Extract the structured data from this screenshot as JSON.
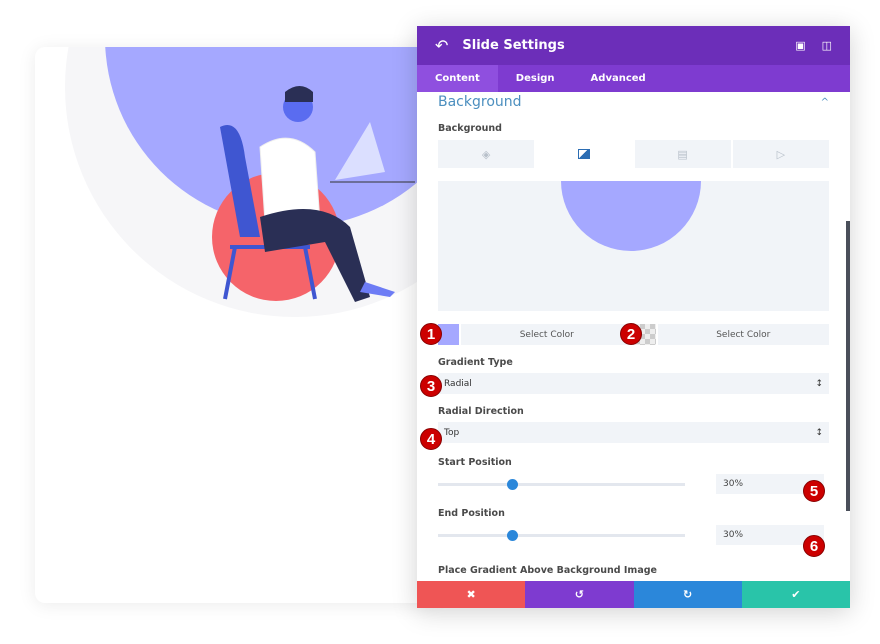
{
  "panel": {
    "title": "Slide Settings",
    "tabs": [
      "Content",
      "Design",
      "Advanced"
    ],
    "active_tab": "Content"
  },
  "section": {
    "title": "Background",
    "field_label": "Background",
    "bg_types": [
      "color",
      "gradient",
      "image",
      "video"
    ],
    "active_type": "gradient"
  },
  "gradient": {
    "color1": "#a5a8ff",
    "color1_label": "Select Color",
    "color2": "transparent",
    "color2_label": "Select Color",
    "type_label": "Gradient Type",
    "type_value": "Radial",
    "direction_label": "Radial Direction",
    "direction_value": "Top",
    "start_label": "Start Position",
    "start_value": "30%",
    "start_percent": 30,
    "end_label": "End Position",
    "end_value": "30%",
    "end_percent": 30,
    "next_label": "Place Gradient Above Background Image"
  },
  "annotations": [
    "1",
    "2",
    "3",
    "4",
    "5",
    "6"
  ],
  "footer": [
    "cancel",
    "undo",
    "redo",
    "save"
  ],
  "colors": {
    "header": "#6c2eb9",
    "tabs": "#7e3bd0",
    "cancel": "#ef5555",
    "undo": "#7e3bd0",
    "redo": "#2b87da",
    "save": "#29c4a9"
  }
}
